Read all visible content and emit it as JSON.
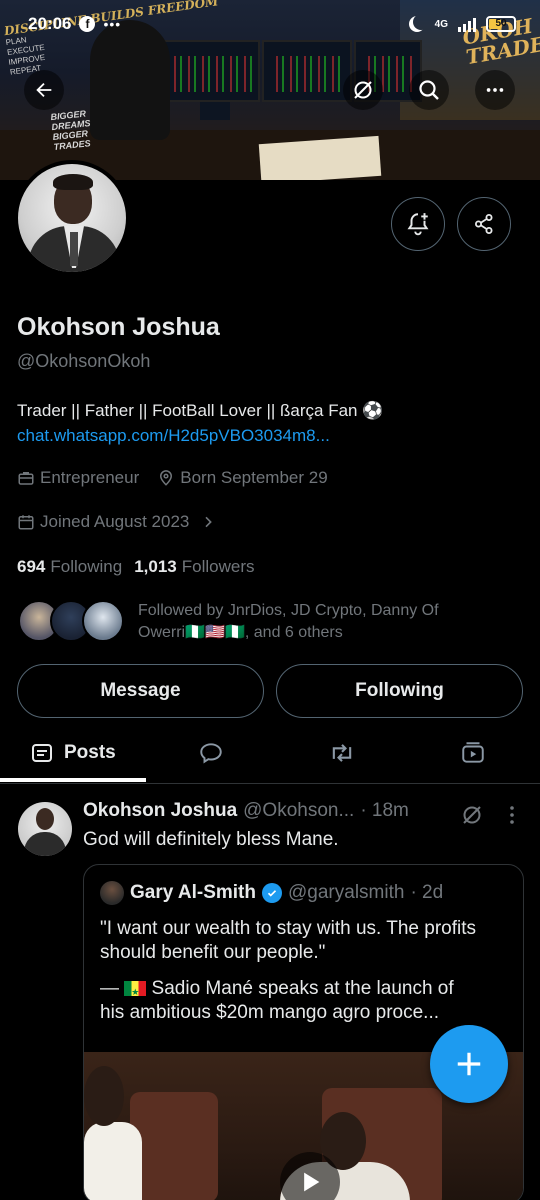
{
  "status_bar": {
    "time": "20:06",
    "network": "4G",
    "battery": "50",
    "battery_fraction": 0.5
  },
  "banner": {
    "left_sign": "DISCIPLINE BUILDS FREEDOM",
    "left_checklist": [
      "PLAN",
      "EXECUTE",
      "IMPROVE",
      "REPEAT"
    ],
    "dreams_text": "BIGGER DREAMS BIGGER TRADES",
    "brand": "OKOH TRADES"
  },
  "profile": {
    "name": "Okohson Joshua",
    "handle": "@OkohsonOkoh",
    "bio": "Trader || Father || FootBall Lover || ßarça Fan ⚽",
    "link": "chat.whatsapp.com/H2d5pVBO3034m8...",
    "category": "Entrepreneur",
    "born": "Born September 29",
    "joined": "Joined August 2023",
    "following_count": "694",
    "following_label": "Following",
    "followers_count": "1,013",
    "followers_label": "Followers",
    "followed_by_line1": "Followed by JnrDios, JD Crypto, Danny Of",
    "followed_by_line2": "Owerri🇳🇬🇺🇸🇳🇬, and 6 others"
  },
  "buttons": {
    "message": "Message",
    "following": "Following"
  },
  "tabs": [
    {
      "label": "Posts",
      "active": true
    }
  ],
  "post": {
    "author_name": "Okohson Joshua",
    "author_handle": "@Okohson...",
    "time": "· 18m",
    "text": "God will definitely bless Mane.",
    "quote": {
      "author_name": "Gary Al-Smith",
      "author_handle": "@garyalsmith",
      "time": "· 2d",
      "paragraph1": "\"I want our wealth to stay with us. The profits should benefit our people.\"",
      "paragraph2_prefix": "— ",
      "paragraph2_line1": " Sadio Mané speaks at the launch of",
      "paragraph2_line2": "his ambitious $20m mango agro proce..."
    }
  },
  "colors": {
    "accent": "#1d9bf0",
    "background": "#000000",
    "text": "#e7e9ea",
    "muted": "#71767b",
    "border": "#2f3336"
  },
  "icons": [
    "back-arrow-icon",
    "grok-icon",
    "search-icon",
    "more-icon",
    "notification-add-icon",
    "share-icon",
    "briefcase-icon",
    "location-pin-icon",
    "calendar-icon",
    "chevron-right-icon",
    "posts-icon",
    "replies-icon",
    "retweet-icon",
    "media-icon",
    "verified-icon",
    "play-icon",
    "compose-plus-icon"
  ]
}
